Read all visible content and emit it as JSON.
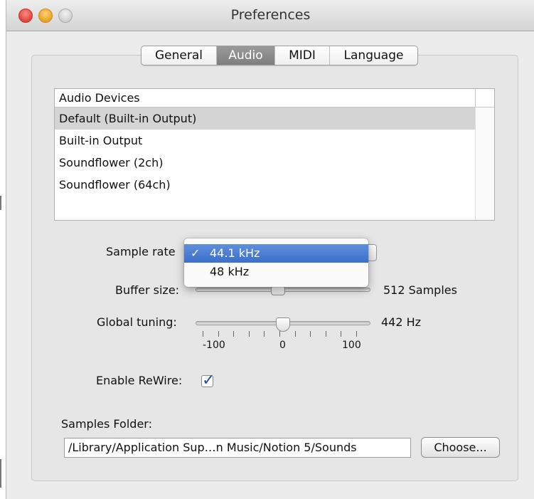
{
  "window": {
    "title": "Preferences"
  },
  "tabs": [
    {
      "label": "General"
    },
    {
      "label": "Audio",
      "selected": true
    },
    {
      "label": "MIDI"
    },
    {
      "label": "Language"
    }
  ],
  "audio_devices": {
    "header": "Audio Devices",
    "items": [
      {
        "label": "Default (Built-in Output)",
        "selected": true
      },
      {
        "label": "Built-in Output"
      },
      {
        "label": "Soundflower (2ch)"
      },
      {
        "label": "Soundflower (64ch)"
      }
    ]
  },
  "sample_rate": {
    "label": "Sample rate",
    "options": [
      {
        "label": "44.1 kHz",
        "checked": true,
        "check_glyph": "✓"
      },
      {
        "label": "48 kHz"
      }
    ]
  },
  "buffer_size": {
    "label": "Buffer size:",
    "value_text": "512 Samples",
    "slider_fraction": 0.47
  },
  "global_tuning": {
    "label": "Global tuning:",
    "value_text": "442 Hz",
    "slider_fraction": 0.5,
    "tick_labels": [
      "-100",
      "0",
      "100"
    ]
  },
  "rewire": {
    "label": "Enable ReWire:",
    "checked": true,
    "check_glyph": "✓"
  },
  "samples_folder": {
    "label": "Samples Folder:",
    "path": "/Library/Application Sup…n Music/Notion 5/Sounds",
    "choose_label": "Choose..."
  },
  "colors": {
    "accent_highlight": "#3a6fcb",
    "selected_tab": "#888888",
    "checkbox_mark": "#1f4fa8"
  }
}
